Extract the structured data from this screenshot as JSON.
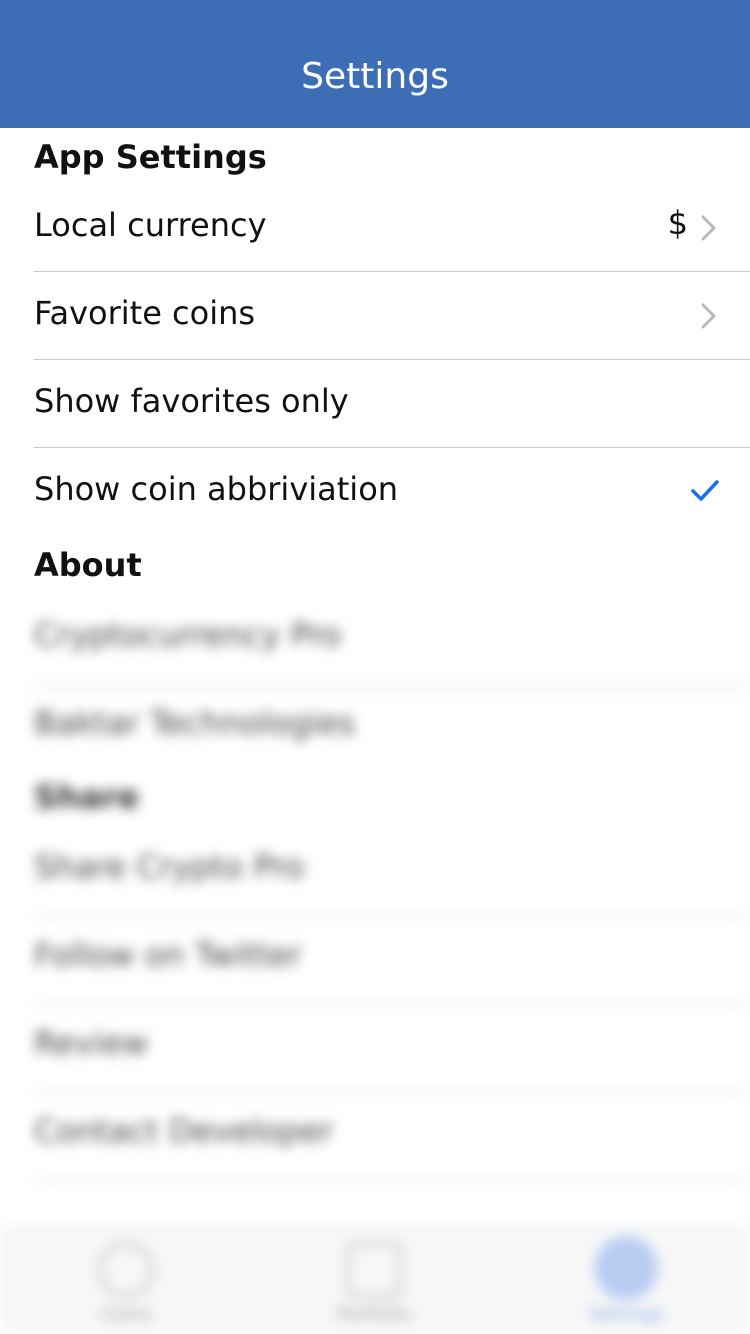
{
  "nav": {
    "title": "Settings"
  },
  "sections": {
    "app_settings": {
      "header": "App Settings",
      "rows": {
        "local_currency": {
          "label": "Local currency",
          "value": "$"
        },
        "favorite_coins": {
          "label": "Favorite coins"
        },
        "show_favorites_only": {
          "label": "Show favorites only"
        },
        "show_coin_abbreviation": {
          "label": "Show coin abbriviation",
          "checked": true
        }
      }
    },
    "about": {
      "header": "About",
      "rows": [
        "Cryptocurrency Pro",
        "Baktar Technologies"
      ]
    },
    "share": {
      "header": "Share",
      "rows": [
        "Share Crypto Pro",
        "Follow on Twitter",
        "Review",
        "Contact Developer"
      ]
    }
  },
  "tabbar": {
    "tabs": [
      {
        "icon": "coins-icon",
        "label": "Coins"
      },
      {
        "icon": "portfolio-icon",
        "label": "Portfolio"
      },
      {
        "icon": "settings-icon",
        "label": "Settings",
        "active": true
      }
    ]
  },
  "colors": {
    "nav_background": "#3d6db4",
    "accent": "#1a6ff0",
    "divider": "#c8c7cc"
  }
}
